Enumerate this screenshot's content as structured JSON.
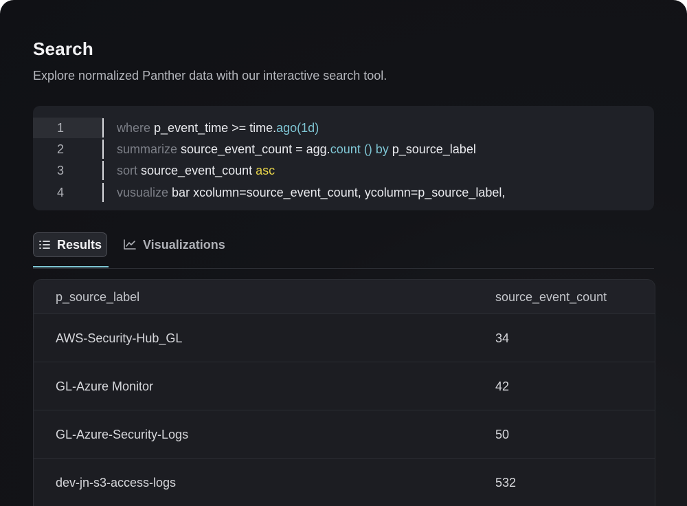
{
  "header": {
    "title": "Search",
    "subtitle": "Explore normalized Panther data with our interactive search tool."
  },
  "editor": {
    "lines": [
      {
        "number": "1",
        "segments": [
          {
            "t": "where ",
            "c": "kw"
          },
          {
            "t": "p_event_time >= time.",
            "c": ""
          },
          {
            "t": "ago(1d)",
            "c": "fn"
          }
        ]
      },
      {
        "number": "2",
        "segments": [
          {
            "t": "summarize ",
            "c": "kw"
          },
          {
            "t": "source_event_count = agg.",
            "c": ""
          },
          {
            "t": "count () by",
            "c": "fn"
          },
          {
            "t": " p_source_label",
            "c": ""
          }
        ]
      },
      {
        "number": "3",
        "segments": [
          {
            "t": "sort ",
            "c": "kw"
          },
          {
            "t": "source_event_count ",
            "c": ""
          },
          {
            "t": "asc",
            "c": "yl"
          }
        ]
      },
      {
        "number": "4",
        "segments": [
          {
            "t": "vusualize ",
            "c": "kw"
          },
          {
            "t": "bar xcolumn=source_event_count, ycolumn=p_source_label,",
            "c": ""
          }
        ]
      }
    ]
  },
  "tabs": {
    "results": {
      "label": "Results",
      "icon": "list-icon",
      "active": true
    },
    "visualizations": {
      "label": "Visualizations",
      "icon": "line-chart-icon",
      "active": false
    }
  },
  "table": {
    "columns": [
      "p_source_label",
      "source_event_count"
    ],
    "rows": [
      [
        "AWS-Security-Hub_GL",
        "34"
      ],
      [
        "GL-Azure Monitor",
        "42"
      ],
      [
        "GL-Azure-Security-Logs",
        "50"
      ],
      [
        "dev-jn-s3-access-logs",
        "532"
      ]
    ]
  },
  "colors": {
    "accent": "#7fc6d4",
    "keyword": "#7c7f87",
    "highlight": "#e6d34a",
    "background": "#131418"
  }
}
